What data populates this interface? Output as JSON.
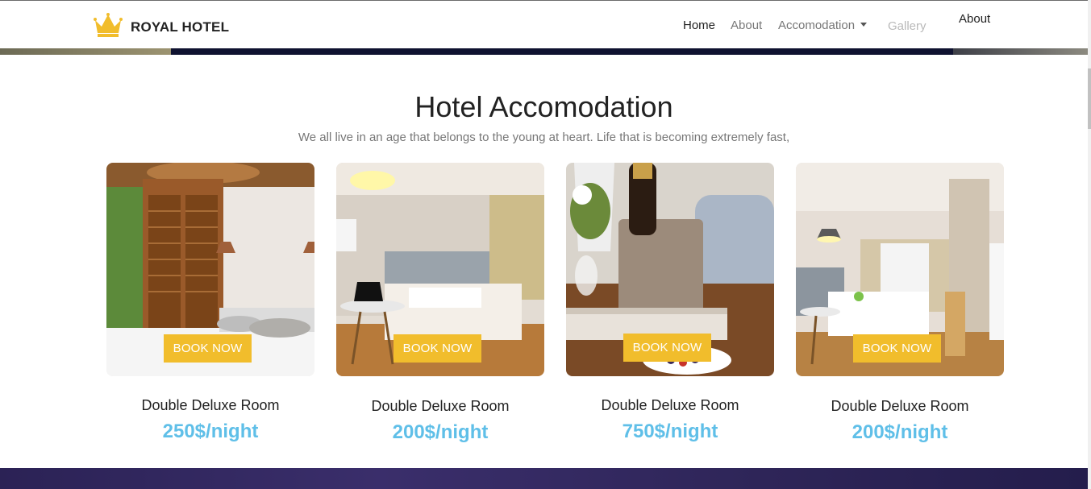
{
  "brand": {
    "name": "ROYAL HOTEL",
    "icon": "crown-icon",
    "icon_color": "#f1bd2c"
  },
  "nav": {
    "home": "Home",
    "about": "About",
    "accommodation": "Accomodation",
    "gallery": "Gallery",
    "about_extra": "About"
  },
  "section": {
    "title": "Hotel Accomodation",
    "subtitle": "We all live in an age that belongs to the young at heart. Life that is becoming extremely fast,"
  },
  "rooms": [
    {
      "name": "Double Deluxe Room",
      "price": "250$/night",
      "button": "BOOK NOW"
    },
    {
      "name": "Double Deluxe Room",
      "price": "200$/night",
      "button": "BOOK NOW"
    },
    {
      "name": "Double Deluxe Room",
      "price": "750$/night",
      "button": "BOOK NOW"
    },
    {
      "name": "Double Deluxe Room",
      "price": "200$/night",
      "button": "BOOK NOW"
    }
  ],
  "colors": {
    "accent": "#f1bd2c",
    "price": "#5fbfe8",
    "text": "#222222",
    "muted": "#777777"
  }
}
